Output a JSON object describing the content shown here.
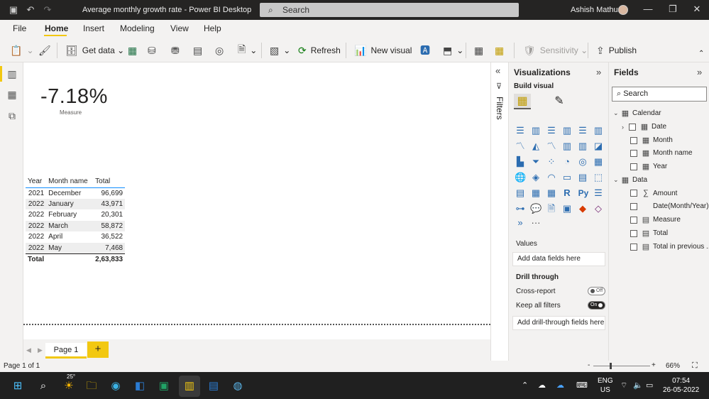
{
  "window": {
    "title": "Average monthly growth rate - Power BI Desktop",
    "search_label": "Search",
    "user_name": "Ashish Mathur"
  },
  "menu": {
    "items": [
      "File",
      "Home",
      "Insert",
      "Modeling",
      "View",
      "Help"
    ],
    "active": "Home"
  },
  "ribbon": {
    "get_data": "Get data",
    "refresh": "Refresh",
    "new_visual": "New visual",
    "sensitivity": "Sensitivity",
    "publish": "Publish"
  },
  "card": {
    "value": "-7.18%",
    "label": "Measure"
  },
  "table": {
    "headers": [
      "Year",
      "Month name",
      "Total"
    ],
    "rows": [
      [
        "2021",
        "December",
        "96,699"
      ],
      [
        "2022",
        "January",
        "43,971"
      ],
      [
        "2022",
        "February",
        "20,301"
      ],
      [
        "2022",
        "March",
        "58,872"
      ],
      [
        "2022",
        "April",
        "36,522"
      ],
      [
        "2022",
        "May",
        "7,468"
      ]
    ],
    "total_label": "Total",
    "total_value": "2,63,833"
  },
  "pages": {
    "tab": "Page 1",
    "add": "+"
  },
  "filters_label": "Filters",
  "visualizations": {
    "title": "Visualizations",
    "build_visual": "Build visual",
    "values_label": "Values",
    "values_placeholder": "Add data fields here",
    "drill_through": "Drill through",
    "cross_report": "Cross-report",
    "cross_report_state": "Off",
    "keep_all_filters": "Keep all filters",
    "keep_all_filters_state": "On",
    "drill_placeholder": "Add drill-through fields here",
    "more": "···",
    "icon_glyphs": [
      "R",
      "Py"
    ]
  },
  "fields": {
    "title": "Fields",
    "search_placeholder": "Search",
    "tables": [
      {
        "name": "Calendar",
        "fields": [
          "Date",
          "Month",
          "Month name",
          "Year"
        ]
      },
      {
        "name": "Data",
        "fields": [
          "Amount",
          "Date(Month/Year)",
          "Measure",
          "Total",
          "Total in previous ..."
        ]
      }
    ]
  },
  "status": {
    "page_indicator": "Page 1 of 1",
    "zoom": "66%",
    "zoom_minus": "-",
    "zoom_plus": "+"
  },
  "taskbar": {
    "weather_temp": "25°",
    "lang_line1": "ENG",
    "lang_line2": "US",
    "time": "07:54",
    "date": "26-05-2022"
  },
  "colors": {
    "accent_yellow": "#f2c811",
    "table_header_line": "#118dff",
    "titlebar": "#252423"
  }
}
